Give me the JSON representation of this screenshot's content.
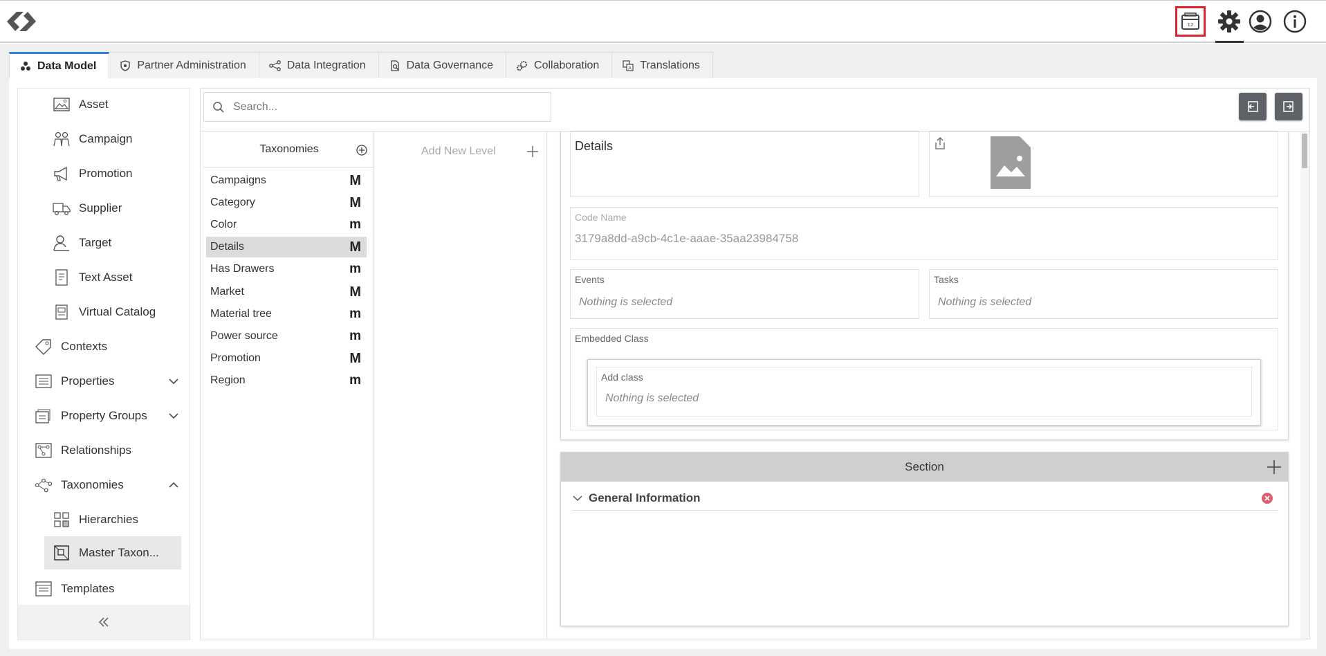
{
  "tabs": [
    {
      "label": "Data Model",
      "icon": "cubes-icon"
    },
    {
      "label": "Partner Administration",
      "icon": "shield-icon"
    },
    {
      "label": "Data Integration",
      "icon": "share-nodes-icon"
    },
    {
      "label": "Data Governance",
      "icon": "document-search-icon"
    },
    {
      "label": "Collaboration",
      "icon": "gears-icon"
    },
    {
      "label": "Translations",
      "icon": "translate-icon"
    }
  ],
  "sidebar": {
    "items": [
      {
        "label": "Asset",
        "icon": "image-icon"
      },
      {
        "label": "Campaign",
        "icon": "people-group-icon"
      },
      {
        "label": "Promotion",
        "icon": "megaphone-icon"
      },
      {
        "label": "Supplier",
        "icon": "truck-icon"
      },
      {
        "label": "Target",
        "icon": "user-target-icon"
      },
      {
        "label": "Text Asset",
        "icon": "text-document-icon"
      },
      {
        "label": "Virtual Catalog",
        "icon": "catalog-icon"
      },
      {
        "label": "Contexts",
        "icon": "tag-icon"
      },
      {
        "label": "Properties",
        "icon": "properties-icon"
      },
      {
        "label": "Property Groups",
        "icon": "property-groups-icon"
      },
      {
        "label": "Relationships",
        "icon": "relationships-icon"
      },
      {
        "label": "Taxonomies",
        "icon": "taxonomy-icon"
      },
      {
        "label": "Hierarchies",
        "icon": "hierarchy-icon"
      },
      {
        "label": "Master Taxon...",
        "icon": "master-taxonomy-icon"
      },
      {
        "label": "Templates",
        "icon": "template-icon"
      }
    ]
  },
  "search": {
    "placeholder": "Search..."
  },
  "taxonomies": {
    "header": "Taxonomies",
    "items": [
      {
        "label": "Campaigns",
        "badge": "M"
      },
      {
        "label": "Category",
        "badge": "M"
      },
      {
        "label": "Color",
        "badge": "m"
      },
      {
        "label": "Details",
        "badge": "M"
      },
      {
        "label": "Has Drawers",
        "badge": "m"
      },
      {
        "label": "Market",
        "badge": "M"
      },
      {
        "label": "Material tree",
        "badge": "m"
      },
      {
        "label": "Power source",
        "badge": "m"
      },
      {
        "label": "Promotion",
        "badge": "M"
      },
      {
        "label": "Region",
        "badge": "m"
      }
    ]
  },
  "levels": {
    "add_label": "Add New Level"
  },
  "detail": {
    "name": "Details",
    "code_label": "Code Name",
    "code_value": "3179a8dd-a9cb-4c1e-aaae-35aa23984758",
    "events_label": "Events",
    "events_value": "Nothing is selected",
    "tasks_label": "Tasks",
    "tasks_value": "Nothing is selected",
    "embedded_label": "Embedded Class",
    "add_class_label": "Add class",
    "add_class_value": "Nothing is selected"
  },
  "section": {
    "header": "Section",
    "group": "General Information"
  },
  "colors": {
    "accent": "#3b7ddd",
    "highlight": "#e0202a",
    "remove": "#e06070"
  }
}
